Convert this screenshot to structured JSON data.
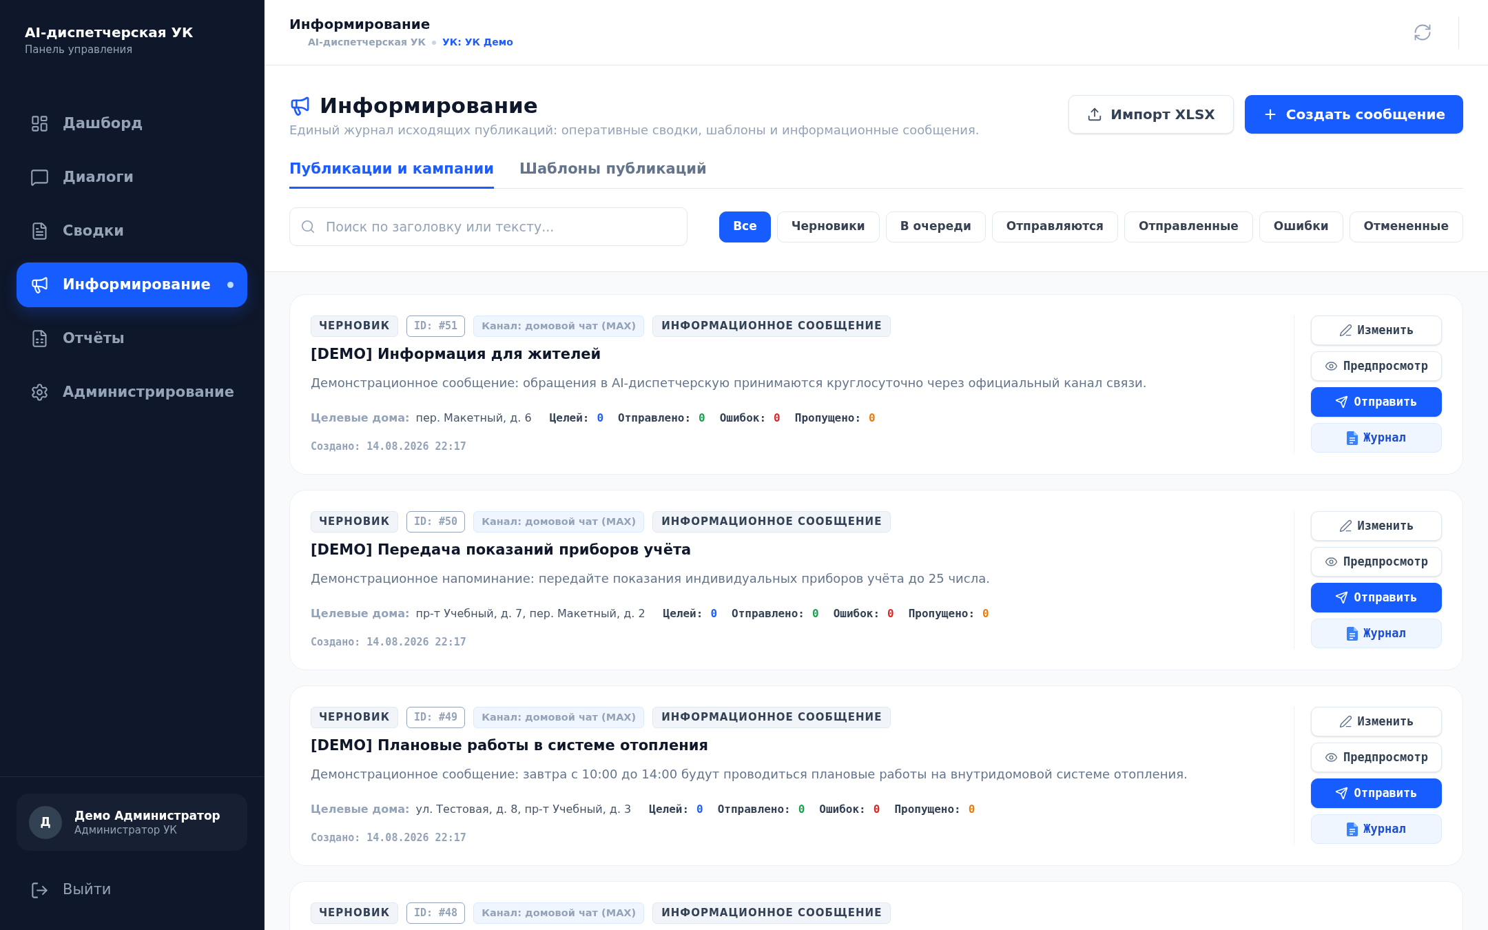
{
  "sidebar": {
    "title": "AI-диспетчерская УК",
    "subtitle": "Панель управления",
    "nav": [
      {
        "label": "Дашборд",
        "selected": false
      },
      {
        "label": "Диалоги",
        "selected": false
      },
      {
        "label": "Сводки",
        "selected": false
      },
      {
        "label": "Информирование",
        "selected": true
      },
      {
        "label": "Отчёты",
        "selected": false
      },
      {
        "label": "Администрирование",
        "selected": false
      }
    ],
    "user": {
      "avatar": "Д",
      "name": "Демо Администратор",
      "role": "Администратор УК"
    },
    "logout": "Выйти"
  },
  "header": {
    "title": "Информирование",
    "breadcrumb": {
      "app": "AI-диспетчерская УК",
      "org": "УК: УК Демо"
    }
  },
  "page": {
    "title": "Информирование",
    "subtitle": "Единый журнал исходящих публикаций: оперативные сводки, шаблоны и информационные сообщения.",
    "buttons": [
      {
        "kind": "secondary",
        "label": "Импорт XLSX"
      },
      {
        "kind": "primary",
        "label": "Создать сообщение"
      }
    ],
    "tabs": [
      {
        "label": "Публикации и кампании",
        "selected": true
      },
      {
        "label": "Шаблоны публикаций",
        "selected": false
      }
    ],
    "search": {
      "placeholder": "Поиск по заголовку или тексту..."
    },
    "filters": [
      {
        "label": "Все",
        "selected": true
      },
      {
        "label": "Черновики",
        "selected": false
      },
      {
        "label": "В очереди",
        "selected": false
      },
      {
        "label": "Отправляются",
        "selected": false
      },
      {
        "label": "Отправленные",
        "selected": false
      },
      {
        "label": "Ошибки",
        "selected": false
      },
      {
        "label": "Отмененные",
        "selected": false
      }
    ]
  },
  "publications": [
    {
      "badges": [
        {
          "kind": "status",
          "text": "ЧЕРНОВИК"
        },
        {
          "kind": "id",
          "text": "ID: #51"
        },
        {
          "kind": "channel",
          "text": "Канал: домовой чат (MAX)"
        },
        {
          "kind": "type",
          "text": "ИНФОРМАЦИОННОЕ СООБЩЕНИЕ"
        }
      ],
      "title": "[DEMO] Информация для жителей",
      "text": "Демонстрационное сообщение: обращения в AI-диспетчерскую принимаются круглосуточно через официальный канал связи.",
      "targets_label": "Целевые дома:",
      "targets": "пер. Макетный, д. 6",
      "stats": [
        {
          "label": "Целей:",
          "value": "0",
          "color": "#1d5cff"
        },
        {
          "label": "Отправлено:",
          "value": "0",
          "color": "#16a34a"
        },
        {
          "label": "Ошибок:",
          "value": "0",
          "color": "#dc2626"
        },
        {
          "label": "Пропущено:",
          "value": "0",
          "color": "#ea7c0c"
        }
      ],
      "created": "Создано: 14.08.2026 22:17",
      "actions": [
        {
          "kind": "edit",
          "label": "Изменить"
        },
        {
          "kind": "preview",
          "label": "Предпросмотр"
        },
        {
          "kind": "send",
          "label": "Отправить"
        },
        {
          "kind": "log",
          "label": "Журнал"
        }
      ]
    },
    {
      "badges": [
        {
          "kind": "status",
          "text": "ЧЕРНОВИК"
        },
        {
          "kind": "id",
          "text": "ID: #50"
        },
        {
          "kind": "channel",
          "text": "Канал: домовой чат (MAX)"
        },
        {
          "kind": "type",
          "text": "ИНФОРМАЦИОННОЕ СООБЩЕНИЕ"
        }
      ],
      "title": "[DEMO] Передача показаний приборов учёта",
      "text": "Демонстрационное напоминание: передайте показания индивидуальных приборов учёта до 25 числа.",
      "targets_label": "Целевые дома:",
      "targets": "пр-т Учебный, д. 7, пер. Макетный, д. 2",
      "stats": [
        {
          "label": "Целей:",
          "value": "0",
          "color": "#1d5cff"
        },
        {
          "label": "Отправлено:",
          "value": "0",
          "color": "#16a34a"
        },
        {
          "label": "Ошибок:",
          "value": "0",
          "color": "#dc2626"
        },
        {
          "label": "Пропущено:",
          "value": "0",
          "color": "#ea7c0c"
        }
      ],
      "created": "Создано: 14.08.2026 22:17",
      "actions": [
        {
          "kind": "edit",
          "label": "Изменить"
        },
        {
          "kind": "preview",
          "label": "Предпросмотр"
        },
        {
          "kind": "send",
          "label": "Отправить"
        },
        {
          "kind": "log",
          "label": "Журнал"
        }
      ]
    },
    {
      "badges": [
        {
          "kind": "status",
          "text": "ЧЕРНОВИК"
        },
        {
          "kind": "id",
          "text": "ID: #49"
        },
        {
          "kind": "channel",
          "text": "Канал: домовой чат (MAX)"
        },
        {
          "kind": "type",
          "text": "ИНФОРМАЦИОННОЕ СООБЩЕНИЕ"
        }
      ],
      "title": "[DEMO] Плановые работы в системе отопления",
      "text": "Демонстрационное сообщение: завтра с 10:00 до 14:00 будут проводиться плановые работы на внутридомовой системе отопления.",
      "targets_label": "Целевые дома:",
      "targets": "ул. Тестовая, д. 8, пр-т Учебный, д. 3",
      "stats": [
        {
          "label": "Целей:",
          "value": "0",
          "color": "#1d5cff"
        },
        {
          "label": "Отправлено:",
          "value": "0",
          "color": "#16a34a"
        },
        {
          "label": "Ошибок:",
          "value": "0",
          "color": "#dc2626"
        },
        {
          "label": "Пропущено:",
          "value": "0",
          "color": "#ea7c0c"
        }
      ],
      "created": "Создано: 14.08.2026 22:17",
      "actions": [
        {
          "kind": "edit",
          "label": "Изменить"
        },
        {
          "kind": "preview",
          "label": "Предпросмотр"
        },
        {
          "kind": "send",
          "label": "Отправить"
        },
        {
          "kind": "log",
          "label": "Журнал"
        }
      ]
    },
    {
      "badges": [
        {
          "kind": "status",
          "text": "ЧЕРНОВИК"
        },
        {
          "kind": "id",
          "text": "ID: #48"
        },
        {
          "kind": "channel",
          "text": "Канал: домовой чат (MAX)"
        },
        {
          "kind": "type",
          "text": "ИНФОРМАЦИОННОЕ СООБЩЕНИЕ"
        }
      ]
    }
  ]
}
